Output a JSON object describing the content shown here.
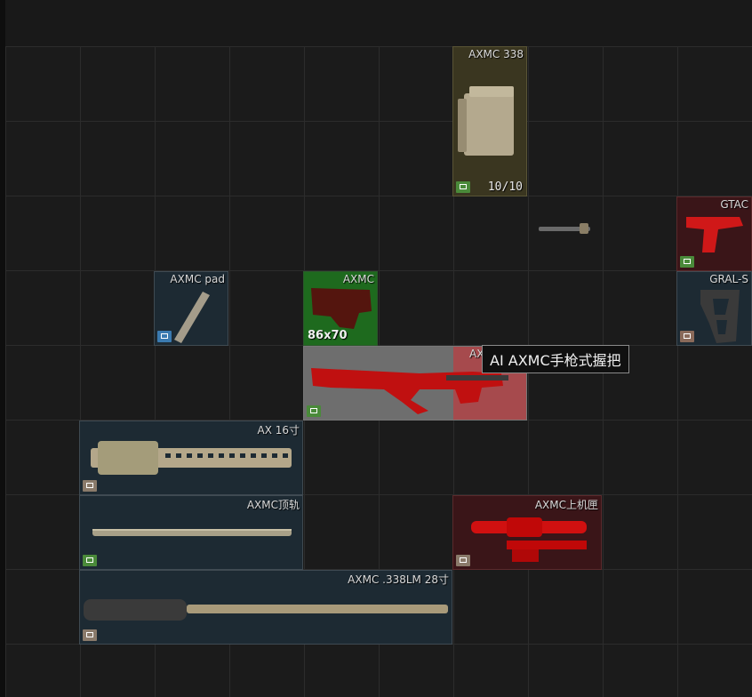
{
  "inventory": {
    "items": {
      "axmc_338_mag": {
        "name": "AXMC 338",
        "count": "10/10",
        "icon": "magazine-icon"
      },
      "gtac": {
        "name": "GTAC",
        "icon": "pistol-grip-icon"
      },
      "axmc_pad": {
        "name": "AXMC pad",
        "icon": "buttpad-icon"
      },
      "axmc_stock": {
        "name": "AXMC",
        "size": "86x70",
        "icon": "stock-icon"
      },
      "gral_s": {
        "name": "GRAL-S",
        "icon": "pistol-grip-icon"
      },
      "axmc_chassis": {
        "name": "AX",
        "icon": "chassis-icon"
      },
      "ax_16": {
        "name": "AX 16寸",
        "icon": "handguard-icon"
      },
      "axmc_top_rail": {
        "name": "AXMC顶轨",
        "icon": "rail-icon"
      },
      "axmc_upper": {
        "name": "AXMC上机匣",
        "icon": "receiver-icon"
      },
      "axmc_barrel": {
        "name": "AXMC .338LM 28寸",
        "icon": "barrel-icon"
      },
      "loose_part": {
        "icon": "barrel-part-icon"
      }
    },
    "tooltip": "AI AXMC手枪式握把"
  }
}
